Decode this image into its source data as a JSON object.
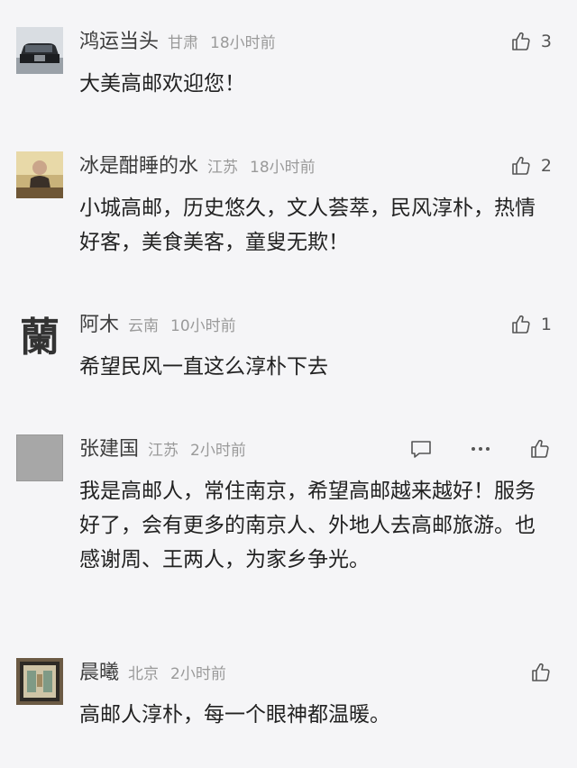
{
  "comments": [
    {
      "author": "鸿运当头",
      "location": "甘肃",
      "time": "18小时前",
      "likes": "3",
      "content": "大美高邮欢迎您！",
      "avatar_icon": "car-avatar-icon"
    },
    {
      "author": "冰是酣睡的水",
      "location": "江苏",
      "time": "18小时前",
      "likes": "2",
      "content": "小城高邮，历史悠久，文人荟萃，民风淳朴，热情好客，美食美客，童叟无欺！",
      "avatar_icon": "person-photo-avatar-icon"
    },
    {
      "author": "阿木",
      "location": "云南",
      "time": "10小时前",
      "likes": "1",
      "content": "希望民风一直这么淳朴下去",
      "avatar_glyph": "蘭"
    },
    {
      "author": "张建国",
      "location": "江苏",
      "time": "2小时前",
      "content": "我是高邮人，常住南京，希望高邮越来越好！服务好了，会有更多的南京人、外地人去高邮旅游。也感谢周、王两人，为家乡争光。",
      "avatar_icon": "gray-placeholder-avatar-icon"
    },
    {
      "author": "晨曦",
      "location": "北京",
      "time": "2小时前",
      "content": "高邮人淳朴，每一个眼神都温暖。",
      "avatar_icon": "framed-picture-avatar-icon"
    }
  ]
}
